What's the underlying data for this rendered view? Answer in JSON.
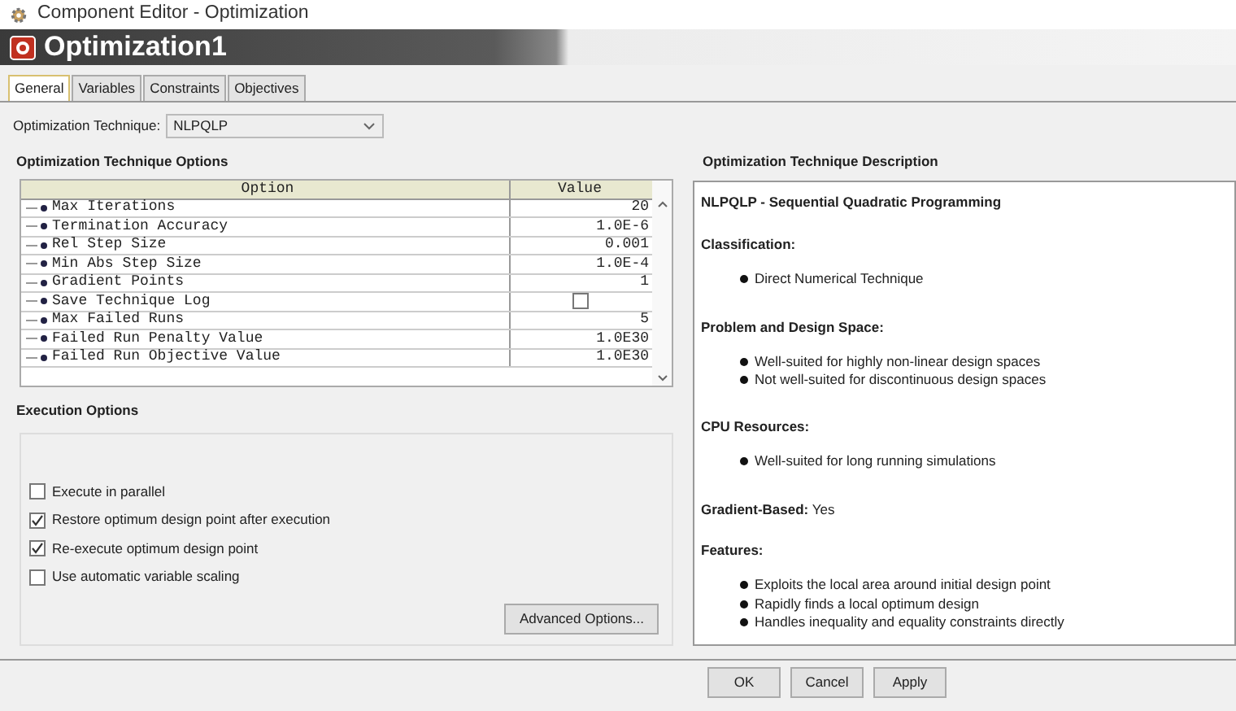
{
  "window": {
    "title": "Component Editor - Optimization"
  },
  "header": {
    "title": "Optimization1"
  },
  "tabs": [
    {
      "label": "General",
      "selected": true
    },
    {
      "label": "Variables",
      "selected": false
    },
    {
      "label": "Constraints",
      "selected": false
    },
    {
      "label": "Objectives",
      "selected": false
    }
  ],
  "technique": {
    "label": "Optimization Technique:",
    "value": "NLPQLP"
  },
  "options_panel": {
    "title": "Optimization Technique Options",
    "columns": [
      "Option",
      "Value"
    ],
    "rows": [
      {
        "name": "Max Iterations",
        "kind": "text",
        "value": "20"
      },
      {
        "name": "Termination Accuracy",
        "kind": "text",
        "value": "1.0E-6"
      },
      {
        "name": "Rel Step Size",
        "kind": "text",
        "value": "0.001"
      },
      {
        "name": "Min Abs Step Size",
        "kind": "text",
        "value": "1.0E-4"
      },
      {
        "name": "Gradient Points",
        "kind": "text",
        "value": "1"
      },
      {
        "name": "Save Technique Log",
        "kind": "checkbox",
        "checked": false
      },
      {
        "name": "Max Failed Runs",
        "kind": "text",
        "value": "5"
      },
      {
        "name": "Failed Run Penalty Value",
        "kind": "text",
        "value": "1.0E30"
      },
      {
        "name": "Failed Run Objective Value",
        "kind": "text",
        "value": "1.0E30"
      }
    ]
  },
  "execution": {
    "title": "Execution Options",
    "options": [
      {
        "label": "Execute in parallel",
        "checked": false
      },
      {
        "label": "Restore optimum design point after execution",
        "checked": true
      },
      {
        "label": "Re-execute optimum design point",
        "checked": true
      },
      {
        "label": "Use automatic variable scaling",
        "checked": false
      }
    ],
    "button": "Advanced Options..."
  },
  "description": {
    "title": "Optimization Technique Description",
    "heading": "NLPQLP - Sequential Quadratic Programming",
    "sections": [
      {
        "kind": "list",
        "title": "Classification:",
        "items": [
          "Direct Numerical Technique"
        ]
      },
      {
        "kind": "list",
        "title": "Problem and Design Space:",
        "items": [
          "Well-suited for highly non-linear design spaces",
          "Not well-suited for discontinuous design spaces"
        ]
      },
      {
        "kind": "list",
        "title": "CPU Resources:",
        "items": [
          "Well-suited for long running simulations"
        ]
      },
      {
        "kind": "inline",
        "title": "Gradient-Based:",
        "value": "Yes"
      },
      {
        "kind": "list",
        "title": "Features:",
        "items": [
          "Exploits the local area around initial design point",
          "Rapidly finds a local optimum design",
          "Handles inequality and equality constraints directly"
        ]
      }
    ]
  },
  "buttons": [
    "OK",
    "Cancel",
    "Apply"
  ]
}
